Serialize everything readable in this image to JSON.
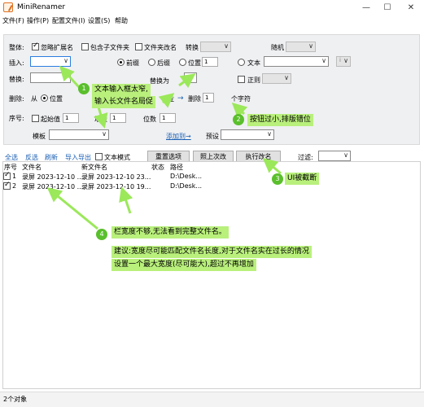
{
  "window": {
    "title": "MiniRenamer",
    "minimize": "—",
    "maximize": "☐",
    "close": "✕"
  },
  "menu": [
    "文件(F)",
    "操作(P)",
    "配置文件(I)",
    "设置(S)",
    "帮助"
  ],
  "panel": {
    "row1": {
      "label": "整体:",
      "ignore_ext": "忽略扩展名",
      "include_subfolders": "包含子文件夹",
      "rename_folders": "文件夹改名",
      "convert": "转换",
      "random": "随机"
    },
    "row2": {
      "label": "插入:",
      "prefix": "前缀",
      "suffix": "后缀",
      "position": "位置",
      "position_value": "1",
      "text": "文本",
      "text_placeholder": "i"
    },
    "row3": {
      "label": "替换:",
      "replace_with": "替换为",
      "regex": "正则"
    },
    "row4": {
      "label": "删除:",
      "from": "从",
      "position": "位置",
      "go": "往",
      "arrow": "→",
      "delete": "删除",
      "count": "1",
      "chars": "个字符"
    },
    "row5": {
      "label": "序号:",
      "start": "起始值",
      "start_value": "1",
      "increment": "增量",
      "increment_value": "1",
      "digits": "位数",
      "digits_value": "1",
      "template": "模板",
      "add_to": "添加到→",
      "preset": "预设"
    }
  },
  "toolbar": {
    "select_all": "全选",
    "invert": "反选",
    "refresh": "刷新",
    "import_export": "导入导出",
    "text_mode": "文本模式",
    "reset": "重置选项",
    "undo": "照上次改",
    "execute": "执行改名",
    "filter": "过滤:"
  },
  "columns": [
    "序号",
    "文件名",
    "新文件名",
    "状态",
    "路径"
  ],
  "rows": [
    {
      "no": "1",
      "name": "录屏 2023-12-10 ...",
      "new_name": "录屏 2023-12-10 23...",
      "status": "",
      "path": "D:\\Desk..."
    },
    {
      "no": "2",
      "name": "录屏 2023-12-10 ...",
      "new_name": "录屏 2023-12-10 19...",
      "status": "",
      "path": "D:\\Desk..."
    }
  ],
  "status": "2个对象",
  "annotations": {
    "c1_line1": "文本输入框太窄,",
    "c1_line2": "输入长文件名局促",
    "c2": "按钮过小,排版错位",
    "c3": "UI被截断",
    "c4": "栏宽度不够,无法看到完整文件名。",
    "c5_line1": "建议:宽度尽可能匹配文件名长度,对于文件名实在过长的情况",
    "c5_line2": "设置一个最大宽度(尽可能大),超过不再增加",
    "badge1": "1",
    "badge2": "2",
    "badge3": "3",
    "badge4": "4"
  },
  "colors": {
    "callout": "#b9f07c",
    "badge": "#5abf2c",
    "accent": "#2a7de1"
  }
}
